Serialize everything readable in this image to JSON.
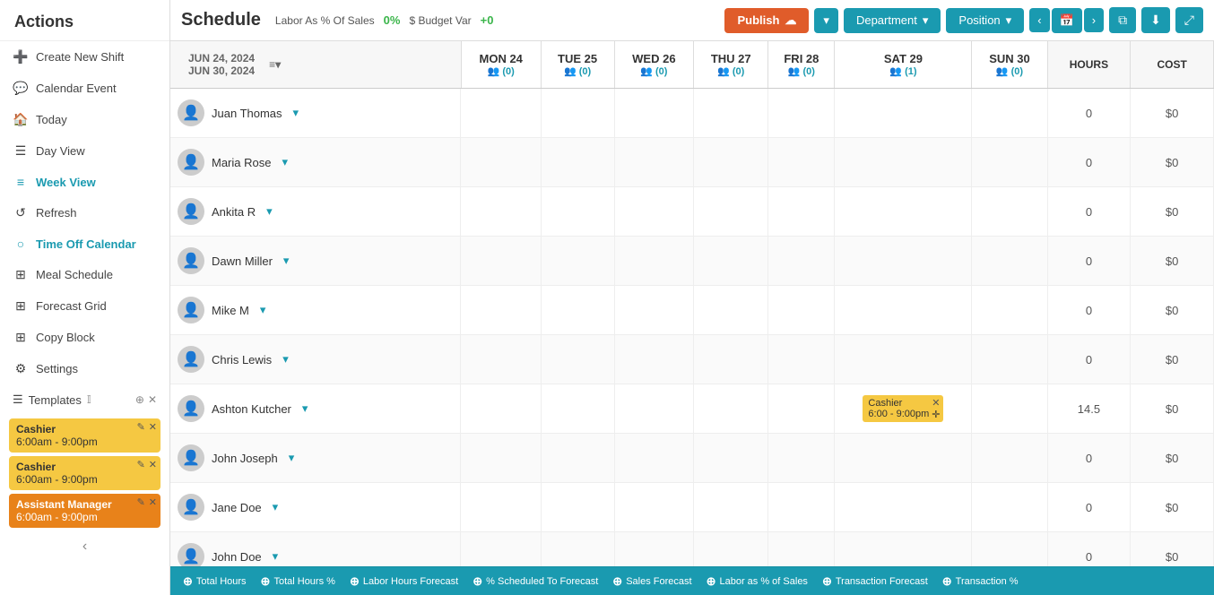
{
  "sidebar": {
    "header": "Actions",
    "items": [
      {
        "id": "create-new-shift",
        "label": "Create New Shift",
        "icon": "➕",
        "active": false
      },
      {
        "id": "calendar-event",
        "label": "Calendar Event",
        "icon": "💬",
        "active": false
      },
      {
        "id": "today",
        "label": "Today",
        "icon": "🏠",
        "active": false
      },
      {
        "id": "day-view",
        "label": "Day View",
        "icon": "☰",
        "active": false
      },
      {
        "id": "week-view",
        "label": "Week View",
        "icon": "≡",
        "active": true
      },
      {
        "id": "refresh",
        "label": "Refresh",
        "icon": "↺",
        "active": false
      },
      {
        "id": "time-off-calendar",
        "label": "Time Off Calendar",
        "icon": "○",
        "active": true
      },
      {
        "id": "meal-schedule",
        "label": "Meal Schedule",
        "icon": "⊞",
        "active": false
      },
      {
        "id": "forecast-grid",
        "label": "Forecast Grid",
        "icon": "⊞",
        "active": false
      },
      {
        "id": "copy-block",
        "label": "Copy Block",
        "icon": "⊞",
        "active": false
      },
      {
        "id": "settings",
        "label": "Settings",
        "icon": "⚙",
        "active": false
      }
    ],
    "templates_label": "Templates",
    "shift_cards": [
      {
        "id": "card1",
        "role": "Cashier",
        "time": "6:00am - 9:00pm",
        "color": "yellow"
      },
      {
        "id": "card2",
        "role": "Cashier",
        "time": "6:00am - 9:00pm",
        "color": "yellow"
      },
      {
        "id": "card3",
        "role": "Assistant Manager",
        "time": "6:00am - 9:00pm",
        "color": "orange"
      }
    ]
  },
  "topbar": {
    "title": "Schedule",
    "labor_label": "Labor As % Of Sales",
    "labor_value": "0%",
    "budget_label": "$ Budget Var",
    "budget_value": "+0",
    "publish_label": "Publish",
    "department_label": "Department",
    "position_label": "Position"
  },
  "schedule": {
    "date_range_from": "JUN 24, 2024",
    "date_range_to": "JUN 30, 2024",
    "columns": [
      {
        "id": "mon24",
        "day": "MON 24",
        "people": 0
      },
      {
        "id": "tue25",
        "day": "TUE 25",
        "people": 0
      },
      {
        "id": "wed26",
        "day": "WED 26",
        "people": 0
      },
      {
        "id": "thu27",
        "day": "THU 27",
        "people": 0
      },
      {
        "id": "fri28",
        "day": "FRI 28",
        "people": 0
      },
      {
        "id": "sat29",
        "day": "SAT 29",
        "people": 1
      },
      {
        "id": "sun30",
        "day": "SUN 30",
        "people": 0
      }
    ],
    "col_hours": "HOURS",
    "col_cost": "COST",
    "employees": [
      {
        "id": "emp1",
        "name": "Juan Thomas",
        "hours": 0,
        "cost": "$0",
        "shifts": {}
      },
      {
        "id": "emp2",
        "name": "Maria Rose",
        "hours": 0,
        "cost": "$0",
        "shifts": {}
      },
      {
        "id": "emp3",
        "name": "Ankita R",
        "hours": 0,
        "cost": "$0",
        "shifts": {}
      },
      {
        "id": "emp4",
        "name": "Dawn Miller",
        "hours": 0,
        "cost": "$0",
        "shifts": {}
      },
      {
        "id": "emp5",
        "name": "Mike M",
        "hours": 0,
        "cost": "$0",
        "shifts": {}
      },
      {
        "id": "emp6",
        "name": "Chris Lewis",
        "hours": 0,
        "cost": "$0",
        "shifts": {}
      },
      {
        "id": "emp7",
        "name": "Ashton Kutcher",
        "hours": 14.5,
        "cost": "$0",
        "shifts": {
          "sat29": {
            "role": "Cashier",
            "time": "6:00 - 9:00pm",
            "color": "yellow"
          }
        }
      },
      {
        "id": "emp8",
        "name": "John Joseph",
        "hours": 0,
        "cost": "$0",
        "shifts": {}
      },
      {
        "id": "emp9",
        "name": "Jane Doe",
        "hours": 0,
        "cost": "$0",
        "shifts": {}
      },
      {
        "id": "emp10",
        "name": "John Doe",
        "hours": 0,
        "cost": "$0",
        "shifts": {}
      }
    ]
  },
  "statsbar": {
    "items": [
      "Total Hours",
      "Total Hours %",
      "Labor Hours Forecast",
      "% Scheduled To Forecast",
      "Sales Forecast",
      "Labor as % of Sales",
      "Transaction Forecast",
      "Transaction %"
    ]
  }
}
